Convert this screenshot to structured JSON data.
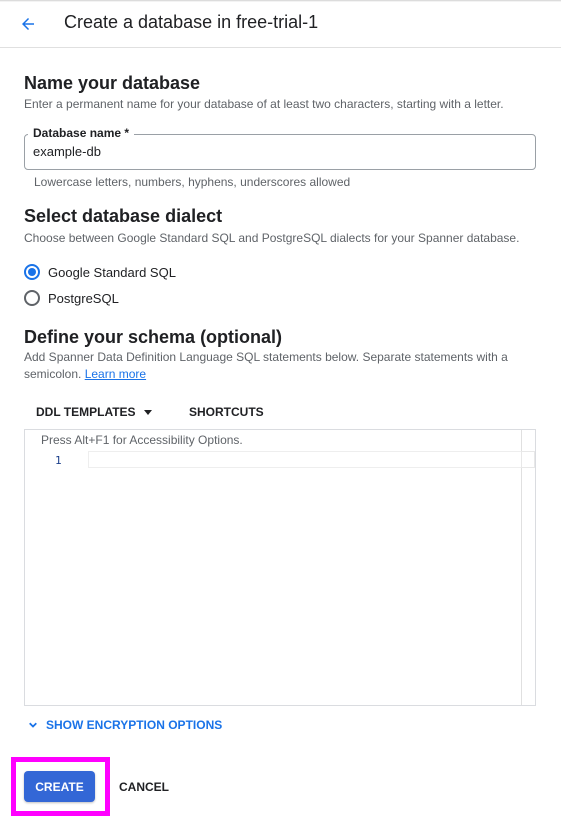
{
  "header": {
    "title": "Create a database in free-trial-1",
    "back_icon": "arrow-back-icon"
  },
  "name_section": {
    "title": "Name your database",
    "description": "Enter a permanent name for your database of at least two characters, starting with a letter.",
    "field_label": "Database name *",
    "field_value": "example-db",
    "hint": "Lowercase letters, numbers, hyphens, underscores allowed"
  },
  "dialect_section": {
    "title": "Select database dialect",
    "description": "Choose between Google Standard SQL and PostgreSQL dialects for your Spanner database.",
    "options": [
      {
        "label": "Google Standard SQL",
        "selected": true
      },
      {
        "label": "PostgreSQL",
        "selected": false
      }
    ]
  },
  "schema_section": {
    "title": "Define your schema (optional)",
    "description": "Add Spanner Data Definition Language SQL statements below. Separate statements with a semicolon.",
    "learn_more": "Learn more",
    "ddl_templates": "DDL TEMPLATES",
    "shortcuts": "SHORTCUTS",
    "editor_help": "Press Alt+F1 for Accessibility Options.",
    "line_number": "1"
  },
  "encryption": {
    "label": "SHOW ENCRYPTION OPTIONS"
  },
  "actions": {
    "create": "CREATE",
    "cancel": "CANCEL"
  },
  "colors": {
    "accent": "#1a73e8",
    "primary_button": "#3367d6",
    "highlight": "#ff00ff"
  }
}
